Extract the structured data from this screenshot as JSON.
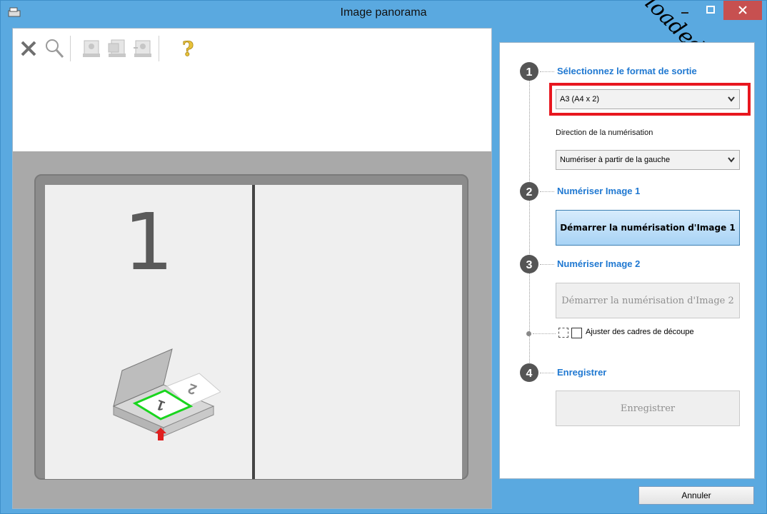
{
  "window": {
    "title": "Image panorama",
    "watermark": "loaded from",
    "accent_color": "#5aa9e0",
    "close_color": "#c75050"
  },
  "toolbar": {
    "icons": [
      "close-x-icon",
      "zoom-icon",
      "scanner-image-icon-1",
      "scanner-image-icon-2",
      "scanner-image-icon-3",
      "help-icon"
    ]
  },
  "preview": {
    "page_number": "1"
  },
  "steps": {
    "step1": {
      "number": "1",
      "title": "Sélectionnez le format de sortie",
      "format_value": "A3 (A4 x 2)",
      "direction_label": "Direction de la numérisation",
      "direction_value": "Numériser à partir de la gauche"
    },
    "step2": {
      "number": "2",
      "title": "Numériser Image 1",
      "button_label": "Démarrer la numérisation d'Image 1"
    },
    "step3": {
      "number": "3",
      "title": "Numériser Image 2",
      "button_label": "Démarrer la numérisation d'Image 2"
    },
    "crop_checkbox": {
      "label": "Ajuster des cadres de découpe",
      "checked": false
    },
    "step4": {
      "number": "4",
      "title": "Enregistrer",
      "button_label": "Enregistrer"
    }
  },
  "footer": {
    "cancel_label": "Annuler"
  },
  "colors": {
    "highlight": "#e8171f",
    "step_title": "#1f78d1"
  }
}
